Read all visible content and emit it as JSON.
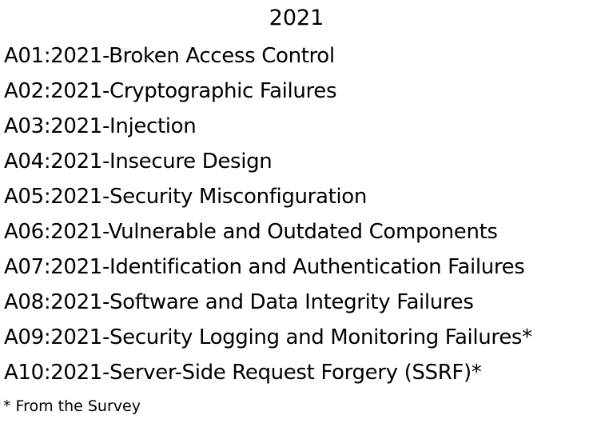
{
  "title": "2021",
  "items": [
    "A01:2021-Broken Access Control",
    "A02:2021-Cryptographic Failures",
    "A03:2021-Injection",
    "A04:2021-Insecure Design",
    "A05:2021-Security Misconfiguration",
    "A06:2021-Vulnerable and Outdated Components",
    "A07:2021-Identification and Authentication Failures",
    "A08:2021-Software and Data Integrity Failures",
    "A09:2021-Security Logging and Monitoring Failures*",
    "A10:2021-Server-Side Request Forgery (SSRF)*"
  ],
  "footnote": "* From the Survey"
}
